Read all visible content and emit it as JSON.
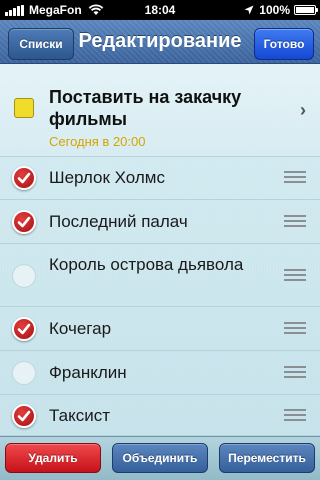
{
  "status_bar": {
    "carrier": "MegaFon",
    "time": "18:04",
    "battery": "100%",
    "battery_level": 1.0,
    "icons": [
      "signal-icon",
      "wifi-icon",
      "location-arrow-icon",
      "battery-icon"
    ]
  },
  "nav": {
    "back_label": "Списки",
    "title": "Редактирование",
    "done_label": "Готово"
  },
  "task": {
    "title": "Поставить на закачку фильмы",
    "subtitle": "Сегодня в 20:00",
    "color": "#f2dc2a"
  },
  "items": [
    {
      "label": "Шерлок Холмс",
      "checked": true
    },
    {
      "label": "Последний палач",
      "checked": true
    },
    {
      "label": "Король острова дьявола",
      "checked": false
    },
    {
      "label": "Кочегар",
      "checked": true
    },
    {
      "label": "Франклин",
      "checked": false
    },
    {
      "label": "Таксист",
      "checked": true
    }
  ],
  "toolbar": {
    "delete_label": "Удалить",
    "merge_label": "Объединить",
    "move_label": "Переместить"
  },
  "colors": {
    "accent_red": "#c5121a",
    "nav_blue": "#3c659f",
    "done_blue": "#1548d4",
    "subtitle_yellow": "#d5a400"
  }
}
